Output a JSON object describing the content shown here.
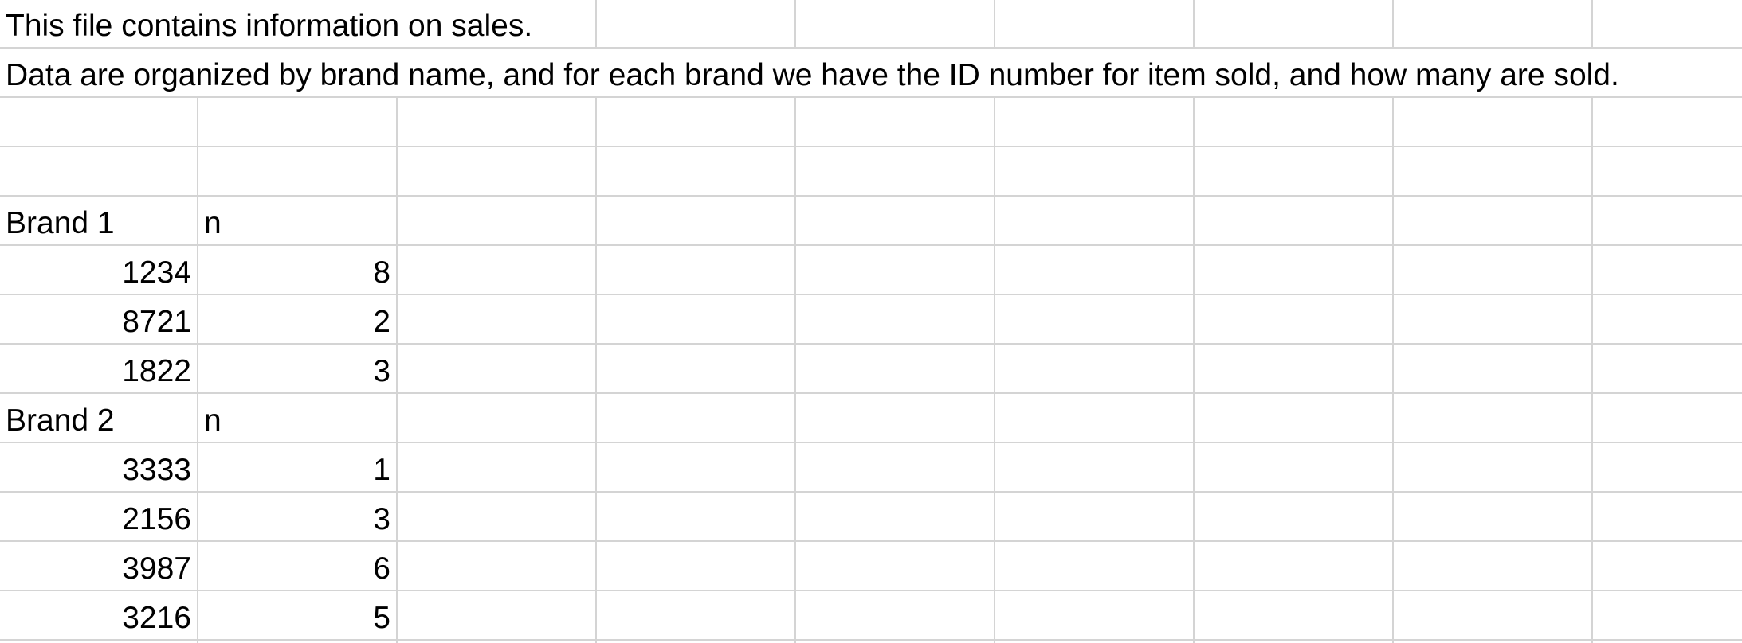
{
  "sheet": {
    "rows": [
      [
        "This file contains information on sales.",
        "",
        "",
        "",
        "",
        "",
        "",
        "",
        ""
      ],
      [
        "Data are organized by brand name, and for each brand we have the ID number for item sold, and how many are sold.",
        "",
        "",
        "",
        "",
        "",
        "",
        "",
        ""
      ],
      [
        "",
        "",
        "",
        "",
        "",
        "",
        "",
        "",
        ""
      ],
      [
        "",
        "",
        "",
        "",
        "",
        "",
        "",
        "",
        ""
      ],
      [
        "Brand 1",
        "n",
        "",
        "",
        "",
        "",
        "",
        "",
        ""
      ],
      [
        "1234",
        "8",
        "",
        "",
        "",
        "",
        "",
        "",
        ""
      ],
      [
        "8721",
        "2",
        "",
        "",
        "",
        "",
        "",
        "",
        ""
      ],
      [
        "1822",
        "3",
        "",
        "",
        "",
        "",
        "",
        "",
        ""
      ],
      [
        "Brand 2",
        "n",
        "",
        "",
        "",
        "",
        "",
        "",
        ""
      ],
      [
        "3333",
        "1",
        "",
        "",
        "",
        "",
        "",
        "",
        ""
      ],
      [
        "2156",
        "3",
        "",
        "",
        "",
        "",
        "",
        "",
        ""
      ],
      [
        "3987",
        "6",
        "",
        "",
        "",
        "",
        "",
        "",
        ""
      ],
      [
        "3216",
        "5",
        "",
        "",
        "",
        "",
        "",
        "",
        ""
      ]
    ]
  }
}
